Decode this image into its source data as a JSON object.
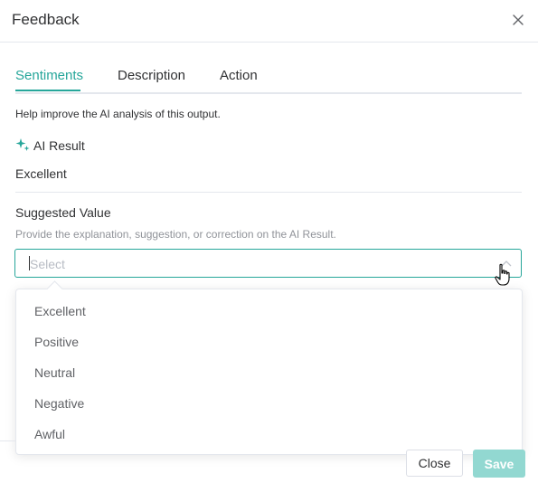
{
  "dialog": {
    "title": "Feedback",
    "close_icon": "close-icon"
  },
  "tabs": [
    {
      "label": "Sentiments",
      "active": true
    },
    {
      "label": "Description",
      "active": false
    },
    {
      "label": "Action",
      "active": false
    }
  ],
  "help_text": "Help improve the AI analysis of this output.",
  "ai_result": {
    "icon": "sparkle-icon",
    "label": "AI Result",
    "value": "Excellent"
  },
  "suggested_value": {
    "label": "Suggested Value",
    "help": "Provide the explanation, suggestion, or correction on the AI Result.",
    "placeholder": "Select",
    "value": "",
    "options": [
      "Excellent",
      "Positive",
      "Neutral",
      "Negative",
      "Awful"
    ]
  },
  "footer": {
    "close_label": "Close",
    "save_label": "Save"
  },
  "colors": {
    "accent": "#26a69a",
    "save_disabled": "#92d8d1",
    "border": "#e4e7ed",
    "muted_text": "#909399"
  }
}
